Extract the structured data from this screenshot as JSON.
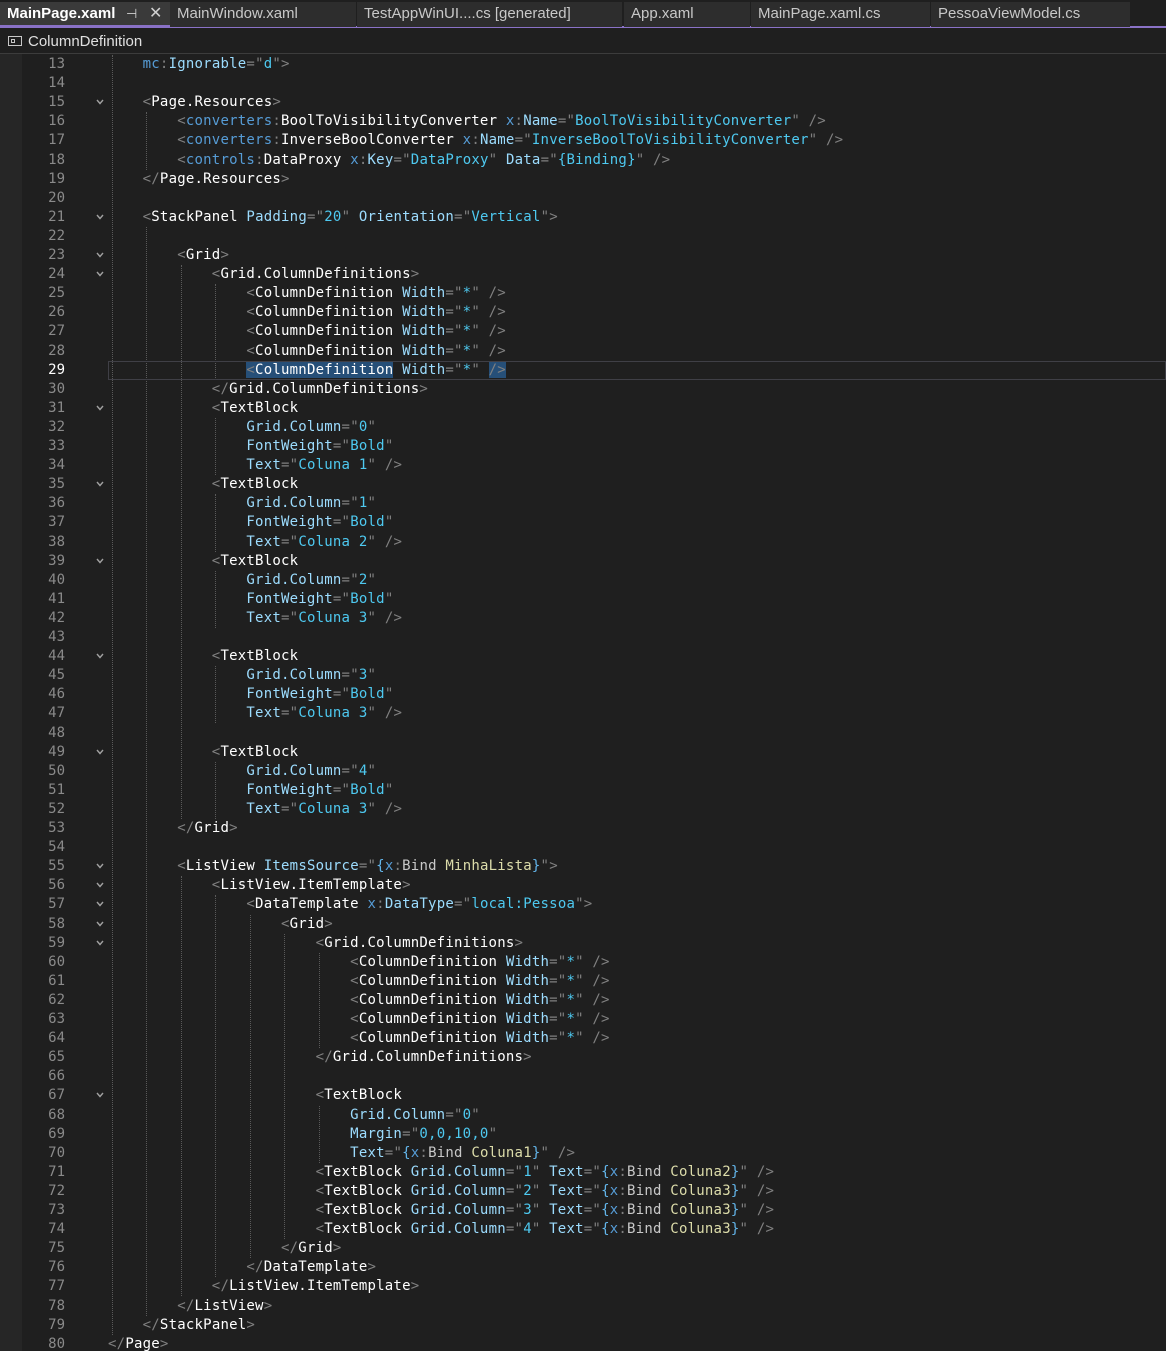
{
  "tabs": [
    {
      "label": "MainPage.xaml",
      "active": true
    },
    {
      "label": "MainWindow.xaml",
      "active": false
    },
    {
      "label": "TestAppWinUI....cs [generated]",
      "active": false
    },
    {
      "label": "App.xaml",
      "active": false
    },
    {
      "label": "MainPage.xaml.cs",
      "active": false
    },
    {
      "label": "PessoaViewModel.cs",
      "active": false
    }
  ],
  "tab_pin_glyph": "⊣",
  "tab_close_glyph": "✕",
  "navigation": {
    "current_member": "ColumnDefinition"
  },
  "editor": {
    "current_line": 29,
    "lines": [
      {
        "n": "13",
        "t": "    mc:Ignorable=\"d\">"
      },
      {
        "n": "14",
        "t": ""
      },
      {
        "n": "15",
        "t": "    <Page.Resources>"
      },
      {
        "n": "16",
        "t": "        <converters:BoolToVisibilityConverter x:Name=\"BoolToVisibilityConverter\" />"
      },
      {
        "n": "17",
        "t": "        <converters:InverseBoolConverter x:Name=\"InverseBoolToVisibilityConverter\" />"
      },
      {
        "n": "18",
        "t": "        <controls:DataProxy x:Key=\"DataProxy\" Data=\"{Binding}\" />"
      },
      {
        "n": "19",
        "t": "    </Page.Resources>"
      },
      {
        "n": "20",
        "t": ""
      },
      {
        "n": "21",
        "t": "    <StackPanel Padding=\"20\" Orientation=\"Vertical\">"
      },
      {
        "n": "22",
        "t": ""
      },
      {
        "n": "23",
        "t": "        <Grid>"
      },
      {
        "n": "24",
        "t": "            <Grid.ColumnDefinitions>"
      },
      {
        "n": "25",
        "t": "                <ColumnDefinition Width=\"*\" />"
      },
      {
        "n": "26",
        "t": "                <ColumnDefinition Width=\"*\" />"
      },
      {
        "n": "27",
        "t": "                <ColumnDefinition Width=\"*\" />"
      },
      {
        "n": "28",
        "t": "                <ColumnDefinition Width=\"*\" />"
      },
      {
        "n": "29",
        "t": "                <ColumnDefinition Width=\"*\" />"
      },
      {
        "n": "30",
        "t": "            </Grid.ColumnDefinitions>"
      },
      {
        "n": "31",
        "t": "            <TextBlock"
      },
      {
        "n": "32",
        "t": "                Grid.Column=\"0\""
      },
      {
        "n": "33",
        "t": "                FontWeight=\"Bold\""
      },
      {
        "n": "34",
        "t": "                Text=\"Coluna 1\" />"
      },
      {
        "n": "35",
        "t": "            <TextBlock"
      },
      {
        "n": "36",
        "t": "                Grid.Column=\"1\""
      },
      {
        "n": "37",
        "t": "                FontWeight=\"Bold\""
      },
      {
        "n": "38",
        "t": "                Text=\"Coluna 2\" />"
      },
      {
        "n": "39",
        "t": "            <TextBlock"
      },
      {
        "n": "40",
        "t": "                Grid.Column=\"2\""
      },
      {
        "n": "41",
        "t": "                FontWeight=\"Bold\""
      },
      {
        "n": "42",
        "t": "                Text=\"Coluna 3\" />"
      },
      {
        "n": "43",
        "t": ""
      },
      {
        "n": "44",
        "t": "            <TextBlock"
      },
      {
        "n": "45",
        "t": "                Grid.Column=\"3\""
      },
      {
        "n": "46",
        "t": "                FontWeight=\"Bold\""
      },
      {
        "n": "47",
        "t": "                Text=\"Coluna 3\" />"
      },
      {
        "n": "48",
        "t": ""
      },
      {
        "n": "49",
        "t": "            <TextBlock"
      },
      {
        "n": "50",
        "t": "                Grid.Column=\"4\""
      },
      {
        "n": "51",
        "t": "                FontWeight=\"Bold\""
      },
      {
        "n": "52",
        "t": "                Text=\"Coluna 3\" />"
      },
      {
        "n": "53",
        "t": "        </Grid>"
      },
      {
        "n": "54",
        "t": ""
      },
      {
        "n": "55",
        "t": "        <ListView ItemsSource=\"{x:Bind MinhaLista}\">"
      },
      {
        "n": "56",
        "t": "            <ListView.ItemTemplate>"
      },
      {
        "n": "57",
        "t": "                <DataTemplate x:DataType=\"local:Pessoa\">"
      },
      {
        "n": "58",
        "t": "                    <Grid>"
      },
      {
        "n": "59",
        "t": "                        <Grid.ColumnDefinitions>"
      },
      {
        "n": "60",
        "t": "                            <ColumnDefinition Width=\"*\" />"
      },
      {
        "n": "61",
        "t": "                            <ColumnDefinition Width=\"*\" />"
      },
      {
        "n": "62",
        "t": "                            <ColumnDefinition Width=\"*\" />"
      },
      {
        "n": "63",
        "t": "                            <ColumnDefinition Width=\"*\" />"
      },
      {
        "n": "64",
        "t": "                            <ColumnDefinition Width=\"*\" />"
      },
      {
        "n": "65",
        "t": "                        </Grid.ColumnDefinitions>"
      },
      {
        "n": "66",
        "t": ""
      },
      {
        "n": "67",
        "t": "                        <TextBlock"
      },
      {
        "n": "68",
        "t": "                            Grid.Column=\"0\""
      },
      {
        "n": "69",
        "t": "                            Margin=\"0,0,10,0\""
      },
      {
        "n": "70",
        "t": "                            Text=\"{x:Bind Coluna1}\" />"
      },
      {
        "n": "71",
        "t": "                        <TextBlock Grid.Column=\"1\" Text=\"{x:Bind Coluna2}\" />"
      },
      {
        "n": "72",
        "t": "                        <TextBlock Grid.Column=\"2\" Text=\"{x:Bind Coluna3}\" />"
      },
      {
        "n": "73",
        "t": "                        <TextBlock Grid.Column=\"3\" Text=\"{x:Bind Coluna3}\" />"
      },
      {
        "n": "74",
        "t": "                        <TextBlock Grid.Column=\"4\" Text=\"{x:Bind Coluna3}\" />"
      },
      {
        "n": "75",
        "t": "                    </Grid>"
      },
      {
        "n": "76",
        "t": "                </DataTemplate>"
      },
      {
        "n": "77",
        "t": "            </ListView.ItemTemplate>"
      },
      {
        "n": "78",
        "t": "        </ListView>"
      },
      {
        "n": "79",
        "t": "    </StackPanel>"
      },
      {
        "n": "80",
        "t": "</Page>"
      }
    ]
  },
  "colors": {
    "accent": "#8a72c7",
    "background": "#1f1f1f",
    "selection": "#264f78"
  }
}
